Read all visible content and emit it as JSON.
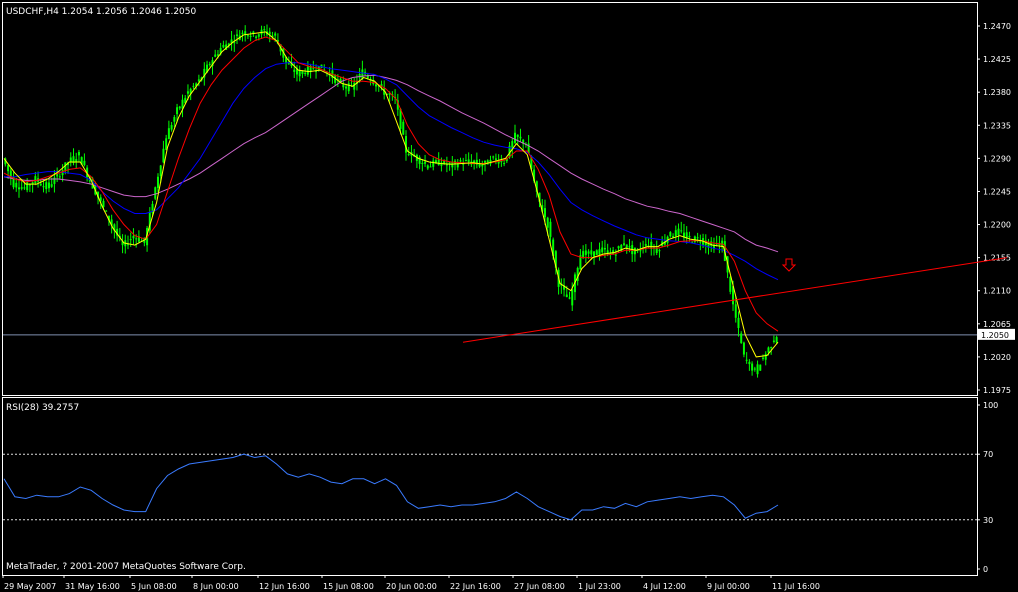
{
  "header": {
    "symbol_line": "USDCHF,H4  1.2054 1.2056 1.2046 1.2050"
  },
  "footer": {
    "copyright": "MetaTrader, ? 2001-2007 MetaQuotes Software Corp."
  },
  "colors": {
    "background": "#000000",
    "frame": "#ffffff",
    "candle": "#00ff00",
    "ma_fast": "#ffff00",
    "ma_mid": "#ff0000",
    "ma_slow": "#0000ff",
    "ma_long": "#cc66cc",
    "trendline": "#ff0000",
    "rsi": "#3a7bff",
    "price_line": "#7f8fb0",
    "arrow": "#ff0000"
  },
  "chart_data": [
    {
      "type": "candlestick",
      "title": "USDCHF,H4  1.2054 1.2056 1.2046 1.2050",
      "ylim": [
        1.1965,
        1.25
      ],
      "y_ticks": [
        1.247,
        1.2425,
        1.238,
        1.2335,
        1.229,
        1.2245,
        1.22,
        1.2155,
        1.211,
        1.2065,
        1.202,
        1.1975
      ],
      "current_price": 1.205,
      "current_price_label": "1.2050",
      "x_tick_labels": [
        "29 May 2007",
        "31 May 16:00",
        "5 Jun 08:00",
        "8 Jun 00:00",
        "12 Jun 16:00",
        "15 Jun 08:00",
        "20 Jun 00:00",
        "22 Jun 16:00",
        "27 Jun 08:00",
        "1 Jul 23:00",
        "4 Jul 12:00",
        "9 Jul 00:00",
        "11 Jul 16:00"
      ],
      "close_path": [
        1.229,
        1.2255,
        1.225,
        1.2262,
        1.225,
        1.2265,
        1.2285,
        1.2295,
        1.226,
        1.223,
        1.22,
        1.217,
        1.2185,
        1.2175,
        1.225,
        1.232,
        1.2355,
        1.238,
        1.2395,
        1.242,
        1.244,
        1.245,
        1.2462,
        1.2458,
        1.2463,
        1.2455,
        1.242,
        1.2405,
        1.241,
        1.2415,
        1.2405,
        1.239,
        1.2385,
        1.2408,
        1.2395,
        1.238,
        1.237,
        1.23,
        1.229,
        1.228,
        1.2285,
        1.228,
        1.2285,
        1.2285,
        1.228,
        1.229,
        1.2285,
        1.232,
        1.231,
        1.224,
        1.22,
        1.212,
        1.2095,
        1.216,
        1.216,
        1.2165,
        1.216,
        1.2175,
        1.216,
        1.2175,
        1.2165,
        1.2185,
        1.219,
        1.218,
        1.218,
        1.217,
        1.2175,
        1.209,
        1.202,
        1.2,
        1.2025,
        1.205
      ],
      "ma_fast": [
        1.229,
        1.227,
        1.2255,
        1.2255,
        1.2262,
        1.2272,
        1.2285,
        1.2285,
        1.226,
        1.2225,
        1.2195,
        1.2175,
        1.2172,
        1.218,
        1.223,
        1.2305,
        1.2345,
        1.2375,
        1.2395,
        1.2415,
        1.2435,
        1.2448,
        1.2458,
        1.246,
        1.2462,
        1.245,
        1.2425,
        1.241,
        1.2408,
        1.241,
        1.2403,
        1.2392,
        1.2388,
        1.24,
        1.2395,
        1.238,
        1.234,
        1.23,
        1.229,
        1.2285,
        1.2283,
        1.2282,
        1.2283,
        1.2284,
        1.2282,
        1.2286,
        1.229,
        1.231,
        1.2295,
        1.224,
        1.218,
        1.212,
        1.211,
        1.214,
        1.2155,
        1.216,
        1.2162,
        1.2168,
        1.2165,
        1.217,
        1.217,
        1.218,
        1.2185,
        1.218,
        1.2178,
        1.2172,
        1.217,
        1.211,
        1.205,
        1.202,
        1.2022,
        1.204
      ],
      "ma_mid": [
        1.227,
        1.2262,
        1.2258,
        1.226,
        1.2265,
        1.227,
        1.2275,
        1.2277,
        1.2265,
        1.2245,
        1.222,
        1.22,
        1.2185,
        1.218,
        1.22,
        1.2245,
        1.229,
        1.233,
        1.2365,
        1.239,
        1.241,
        1.2425,
        1.244,
        1.245,
        1.2455,
        1.245,
        1.2435,
        1.242,
        1.2415,
        1.2412,
        1.2405,
        1.24,
        1.2395,
        1.2395,
        1.2393,
        1.2385,
        1.237,
        1.2335,
        1.231,
        1.2295,
        1.2288,
        1.2285,
        1.2284,
        1.2283,
        1.2283,
        1.2285,
        1.2288,
        1.23,
        1.23,
        1.2275,
        1.224,
        1.219,
        1.216,
        1.2155,
        1.2155,
        1.2158,
        1.216,
        1.2165,
        1.2165,
        1.2168,
        1.2168,
        1.2172,
        1.2177,
        1.2178,
        1.2178,
        1.2175,
        1.2173,
        1.215,
        1.211,
        1.208,
        1.2065,
        1.2055
      ],
      "ma_slow": [
        1.2265,
        1.2265,
        1.2268,
        1.227,
        1.2272,
        1.2272,
        1.227,
        1.2268,
        1.226,
        1.2245,
        1.2232,
        1.2222,
        1.2215,
        1.2215,
        1.222,
        1.2235,
        1.225,
        1.227,
        1.229,
        1.2315,
        1.234,
        1.2365,
        1.2385,
        1.24,
        1.2412,
        1.2418,
        1.242,
        1.242,
        1.2418,
        1.2415,
        1.2412,
        1.241,
        1.2408,
        1.2406,
        1.2404,
        1.2398,
        1.239,
        1.2375,
        1.236,
        1.2348,
        1.234,
        1.2332,
        1.2325,
        1.2318,
        1.2312,
        1.2308,
        1.2305,
        1.2303,
        1.2298,
        1.2285,
        1.2268,
        1.2248,
        1.223,
        1.222,
        1.2212,
        1.2205,
        1.2198,
        1.2192,
        1.2186,
        1.2182,
        1.218,
        1.2178,
        1.2177,
        1.2175,
        1.2172,
        1.2168,
        1.2165,
        1.2158,
        1.215,
        1.214,
        1.2132,
        1.2125
      ],
      "ma_long": [
        1.2265,
        1.2262,
        1.226,
        1.226,
        1.2262,
        1.2262,
        1.226,
        1.2258,
        1.2255,
        1.225,
        1.2245,
        1.224,
        1.2238,
        1.2238,
        1.2242,
        1.2248,
        1.2255,
        1.2262,
        1.227,
        1.228,
        1.229,
        1.23,
        1.231,
        1.2318,
        1.2325,
        1.2335,
        1.2345,
        1.2355,
        1.2365,
        1.2375,
        1.2385,
        1.2395,
        1.24,
        1.2402,
        1.2403,
        1.24,
        1.2396,
        1.239,
        1.2382,
        1.2375,
        1.2368,
        1.236,
        1.2352,
        1.2345,
        1.2338,
        1.233,
        1.2322,
        1.2315,
        1.2308,
        1.23,
        1.229,
        1.228,
        1.227,
        1.2262,
        1.2255,
        1.2248,
        1.2242,
        1.2235,
        1.223,
        1.2225,
        1.2222,
        1.2218,
        1.2215,
        1.221,
        1.2205,
        1.22,
        1.2195,
        1.219,
        1.218,
        1.2172,
        1.2168,
        1.2163
      ],
      "trendline": {
        "start": 1.204,
        "end": 1.2155
      },
      "annotations": [
        {
          "type": "down-arrow",
          "price": 1.2145
        }
      ]
    },
    {
      "type": "line",
      "title": "RSI(28) 39.2757",
      "ylim": [
        0,
        100
      ],
      "y_ticks": [
        100,
        70,
        30,
        0
      ],
      "levels": [
        70,
        30
      ],
      "values": [
        55,
        44,
        43,
        45,
        44,
        44,
        46,
        50,
        48,
        43,
        39,
        36,
        35,
        35,
        49,
        57,
        61,
        64,
        65,
        66,
        67,
        68,
        70,
        68,
        69,
        64,
        58,
        56,
        58,
        56,
        53,
        52,
        55,
        55,
        52,
        55,
        51,
        41,
        37,
        38,
        39,
        38,
        39,
        39,
        40,
        41,
        43,
        47,
        43,
        38,
        35,
        32,
        30,
        36,
        36,
        38,
        37,
        40,
        38,
        41,
        42,
        43,
        44,
        43,
        44,
        45,
        44,
        39,
        31,
        34,
        35,
        39
      ]
    }
  ]
}
